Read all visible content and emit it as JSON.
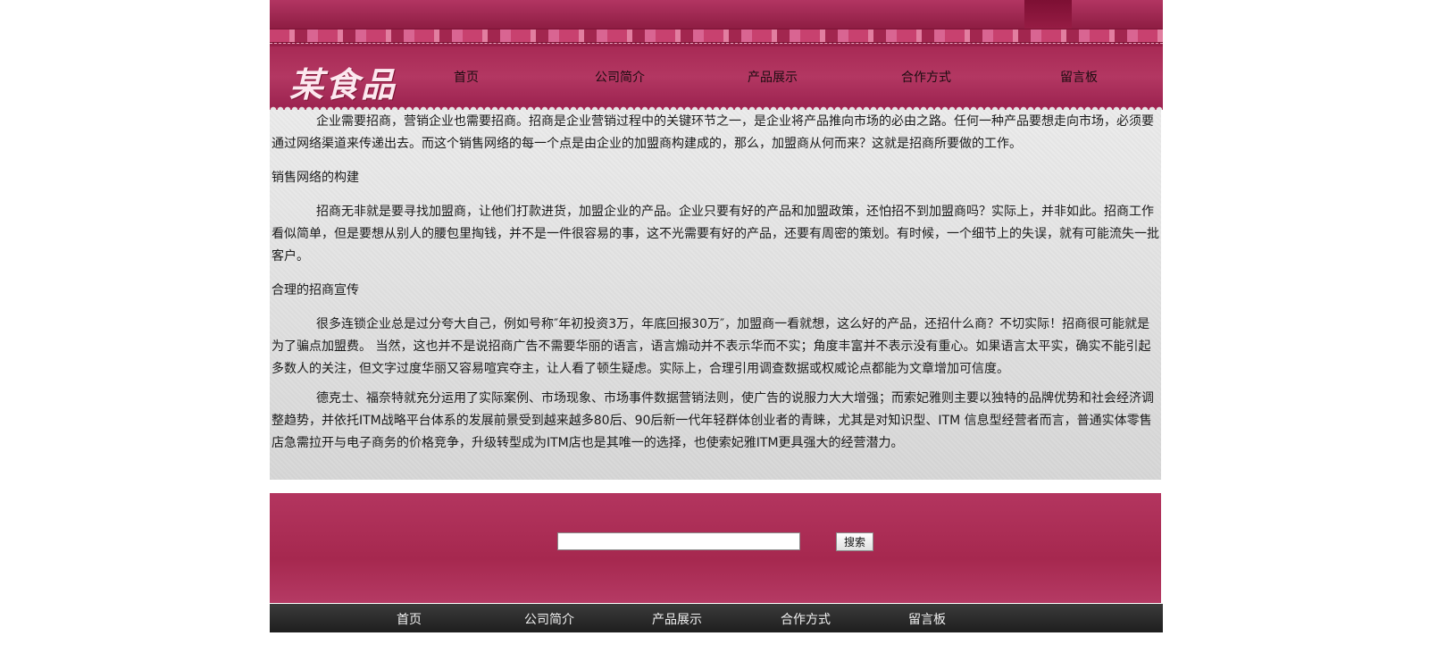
{
  "header": {
    "logo_text": "某食品",
    "nav": [
      "首页",
      "公司简介",
      "产品展示",
      "合作方式",
      "留言板"
    ]
  },
  "content": {
    "p1": "企业需要招商，营销企业也需要招商。招商是企业营销过程中的关键环节之一，是企业将产品推向市场的必由之路。任何一种产品要想走向市场，必须要通过网络渠道来传递出去。而这个销售网络的每一个点是由企业的加盟商构建成的，那么，加盟商从何而来？这就是招商所要做的工作。",
    "h1": "销售网络的构建",
    "p2": "招商无非就是要寻找加盟商，让他们打款进货，加盟企业的产品。企业只要有好的产品和加盟政策，还怕招不到加盟商吗？实际上，并非如此。招商工作看似简单，但是要想从别人的腰包里掏钱，并不是一件很容易的事，这不光需要有好的产品，还要有周密的策划。有时候，一个细节上的失误，就有可能流失一批客户。",
    "h2": "合理的招商宣传",
    "p3": "很多连锁企业总是过分夸大自己，例如号称″年初投资3万，年底回报30万″，加盟商一看就想，这么好的产品，还招什么商？不切实际！招商很可能就是为了骗点加盟费。 当然，这也并不是说招商广告不需要华丽的语言，语言煽动并不表示华而不实；角度丰富并不表示没有重心。如果语言太平实，确实不能引起多数人的关注，但文字过度华丽又容易喧宾夺主，让人看了顿生疑虑。实际上，合理引用调查数据或权威论点都能为文章增加可信度。",
    "p4": "德克士、福奈特就充分运用了实际案例、市场现象、市场事件数据营销法则，使广告的说服力大大增强；而索妃雅则主要以独特的品牌优势和社会经济调整趋势，并依托ITM战略平台体系的发展前景受到越来越多80后、90后新一代年轻群体创业者的青睐，尤其是对知识型、ITM 信息型经营者而言，普通实体零售店急需拉开与电子商务的价格竞争，升级转型成为ITM店也是其唯一的选择，也使索妃雅ITM更具强大的经营潜力。"
  },
  "search": {
    "value": "",
    "button_label": "搜索"
  },
  "footer": {
    "nav": [
      "首页",
      "公司简介",
      "产品展示",
      "合作方式",
      "留言板"
    ]
  }
}
